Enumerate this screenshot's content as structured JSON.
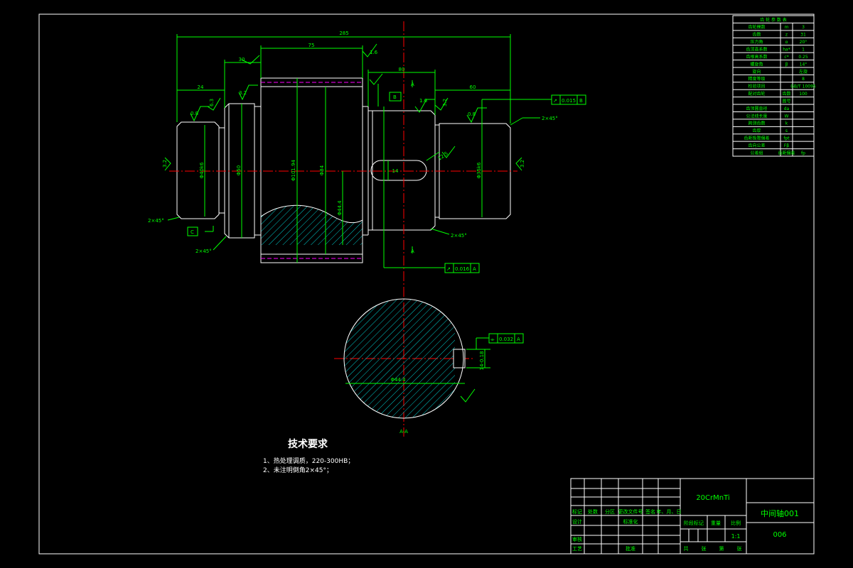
{
  "drawing": {
    "dims": {
      "overall_length": "285",
      "gear_face_width": "75",
      "left_shoulder_len": "30",
      "left_end_len": "24",
      "right_mid_len": "80",
      "right_end_len": "60",
      "key_width": "14",
      "gear_dia": "Φ101.94",
      "root_dia": "Φ84",
      "bearing_dia": "Φ40k6",
      "right_end_dia": "Φ35k6",
      "shoulder_dia": "Φ50",
      "section_dim": "Φ44.4",
      "chamfer_right": "2×45°",
      "chamfer_lower_left1": "2×45°",
      "chamfer_lower_left2": "2×45°",
      "chamfer_lower_right": "2×45°",
      "roughness_a": "1.6",
      "roughness_b": "0.8",
      "roughness_c": "3.2",
      "roughness_d": "6.3",
      "roughness_e": "1.6",
      "roughness_f": "0.8",
      "roughness_g": "3.2",
      "roughness_h": "12.5",
      "datum_a": "A",
      "datum_b": "B",
      "datum_c": "C",
      "section_label_top": "A",
      "section_label_bottom": "A",
      "section_name": "A-A",
      "keyway_depth": "14-0.18",
      "tol_right": {
        "sym": "↗",
        "val": "0.015",
        "ref": "B"
      },
      "tol_mid": {
        "sym": "↗",
        "val": "0.016",
        "ref": "A"
      },
      "tol_section": {
        "sym": "⌯",
        "val": "0.032",
        "ref": "A"
      }
    },
    "params_table": {
      "header": "齿 轮 参 数 表",
      "rows": [
        [
          "齿轮模数",
          "m",
          "3"
        ],
        [
          "齿数",
          "z",
          "31"
        ],
        [
          "压力角",
          "α",
          "20°"
        ],
        [
          "齿顶高系数",
          "ha*",
          "1"
        ],
        [
          "齿根高系数",
          "c*",
          "0.25"
        ],
        [
          "螺旋角",
          "β",
          "14°"
        ],
        [
          "旋向",
          "",
          "左旋"
        ],
        [
          "精度等级",
          "",
          "8"
        ],
        [
          "检验项目",
          "",
          "GB/T 10095"
        ],
        [
          "配对齿轮",
          "齿数",
          "100"
        ],
        [
          "",
          "图号",
          ""
        ],
        [
          "齿顶圆直径",
          "da",
          ""
        ],
        [
          "公法线长度",
          "W",
          ""
        ],
        [
          "跨测齿数",
          "k",
          ""
        ],
        [
          "齿厚",
          "s",
          ""
        ],
        [
          "齿距极限偏差",
          "fpt",
          ""
        ],
        [
          "齿向公差",
          "Fβ",
          ""
        ],
        [
          "公差组",
          "齿距偏差",
          "fp"
        ]
      ]
    },
    "tech_req": {
      "title": "技术要求",
      "items": [
        "1、热处理调质，220-300HB；",
        "2、未注明倒角2×45°；"
      ]
    },
    "title_block": {
      "material": "20CrMnTi",
      "part_name": "中间轴001",
      "drawing_no": "006",
      "scale": "1:1",
      "labels": {
        "mark": "标记",
        "count": "处数",
        "zone": "分区",
        "change_doc": "更改文件号",
        "sign": "签名",
        "date": "年、月、日",
        "design": "设计",
        "standard": "标准化",
        "stage_mark": "阶段标记",
        "weight": "重量",
        "scale_label": "比例",
        "review": "审核",
        "process": "工艺",
        "approve": "批准",
        "sheets_total": "共",
        "sheets_unit": "张",
        "sheet_no": "第",
        "sheet_unit": "张"
      }
    },
    "colors": {
      "background": "#000000",
      "outline": "#ffffff",
      "dimension": "#00ff00",
      "centerline": "#ff0000",
      "hatch": "#00c8c8",
      "pitch_line": "#ff00ff"
    }
  }
}
